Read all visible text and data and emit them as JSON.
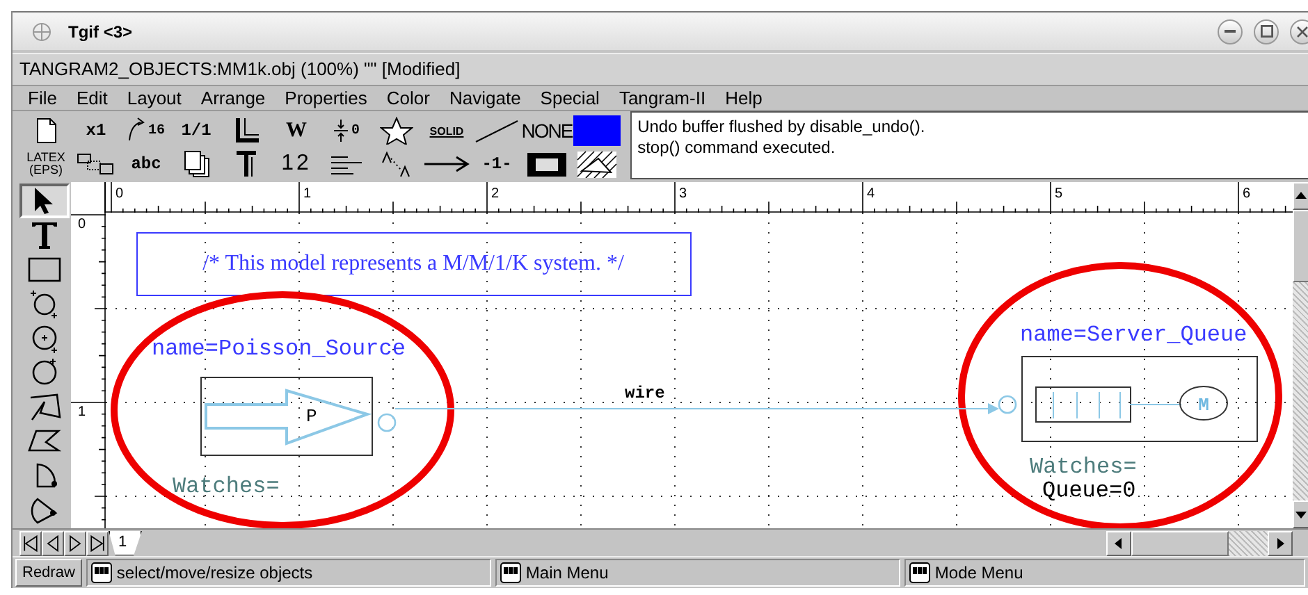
{
  "window": {
    "title": "Tgif <3>"
  },
  "document_title": "TANGRAM2_OBJECTS:MM1k.obj (100%) \"\" [Modified]",
  "menu": [
    "File",
    "Edit",
    "Layout",
    "Arrange",
    "Properties",
    "Color",
    "Navigate",
    "Special",
    "Tangram-II",
    "Help"
  ],
  "toolbar": {
    "rows": [
      [
        {
          "kind": "page"
        },
        {
          "kind": "mono",
          "label": "x1"
        },
        {
          "kind": "rotate",
          "label": "16"
        },
        {
          "kind": "mono",
          "label": "1/1"
        },
        {
          "kind": "linewidth"
        },
        {
          "kind": "serif",
          "label": "W"
        },
        {
          "kind": "kern",
          "label": "0"
        },
        {
          "kind": "star"
        },
        {
          "kind": "solid",
          "label": "SOLID"
        },
        {
          "kind": "line"
        },
        {
          "kind": "narrow",
          "label": "NONE"
        },
        {
          "kind": "swatch",
          "color": "#0000ff"
        }
      ],
      [
        {
          "kind": "latex",
          "label": "LATEX (EPS)"
        },
        {
          "kind": "layout"
        },
        {
          "kind": "mono",
          "label": "abc"
        },
        {
          "kind": "pages"
        },
        {
          "kind": "textstyle"
        },
        {
          "kind": "sans",
          "label": "12"
        },
        {
          "kind": "align"
        },
        {
          "kind": "textspace"
        },
        {
          "kind": "arrow"
        },
        {
          "kind": "mono",
          "label": "-1-"
        },
        {
          "kind": "fillrect"
        },
        {
          "kind": "pattern"
        }
      ]
    ]
  },
  "messages": [
    "Undo buffer flushed by disable_undo().",
    "stop() command executed."
  ],
  "tools": [
    {
      "kind": "select",
      "selected": true
    },
    {
      "kind": "text",
      "selected": false
    },
    {
      "kind": "rect",
      "selected": false
    },
    {
      "kind": "oval_corner",
      "selected": false
    },
    {
      "kind": "oval_center",
      "selected": false
    },
    {
      "kind": "oval_edge",
      "selected": false
    },
    {
      "kind": "polyline",
      "selected": false
    },
    {
      "kind": "polygon",
      "selected": false
    },
    {
      "kind": "arc",
      "selected": false
    },
    {
      "kind": "rcbox",
      "selected": false
    }
  ],
  "ruler": {
    "horizontal": [
      "0",
      "1",
      "2",
      "3",
      "4",
      "5",
      "6"
    ],
    "vertical": [
      "0",
      "1"
    ]
  },
  "canvas": {
    "comment": "/* This model represents a M/M/1/K system. */",
    "objects": [
      {
        "kind": "source",
        "name": "name=Poisson_Source",
        "symbol": "P",
        "watches": "Watches=",
        "highlighted": true
      },
      {
        "kind": "server_queue",
        "name": "name=Server_Queue",
        "symbol": "M",
        "watches": "Watches=",
        "watch_values": [
          "Queue=0"
        ],
        "highlighted": true
      }
    ],
    "wire": {
      "label": "wire"
    }
  },
  "pages": [
    {
      "label": "1",
      "selected": true
    }
  ],
  "status": {
    "button": "Redraw",
    "segments": [
      "select/move/resize objects",
      "Main Menu",
      "Mode Menu"
    ]
  }
}
